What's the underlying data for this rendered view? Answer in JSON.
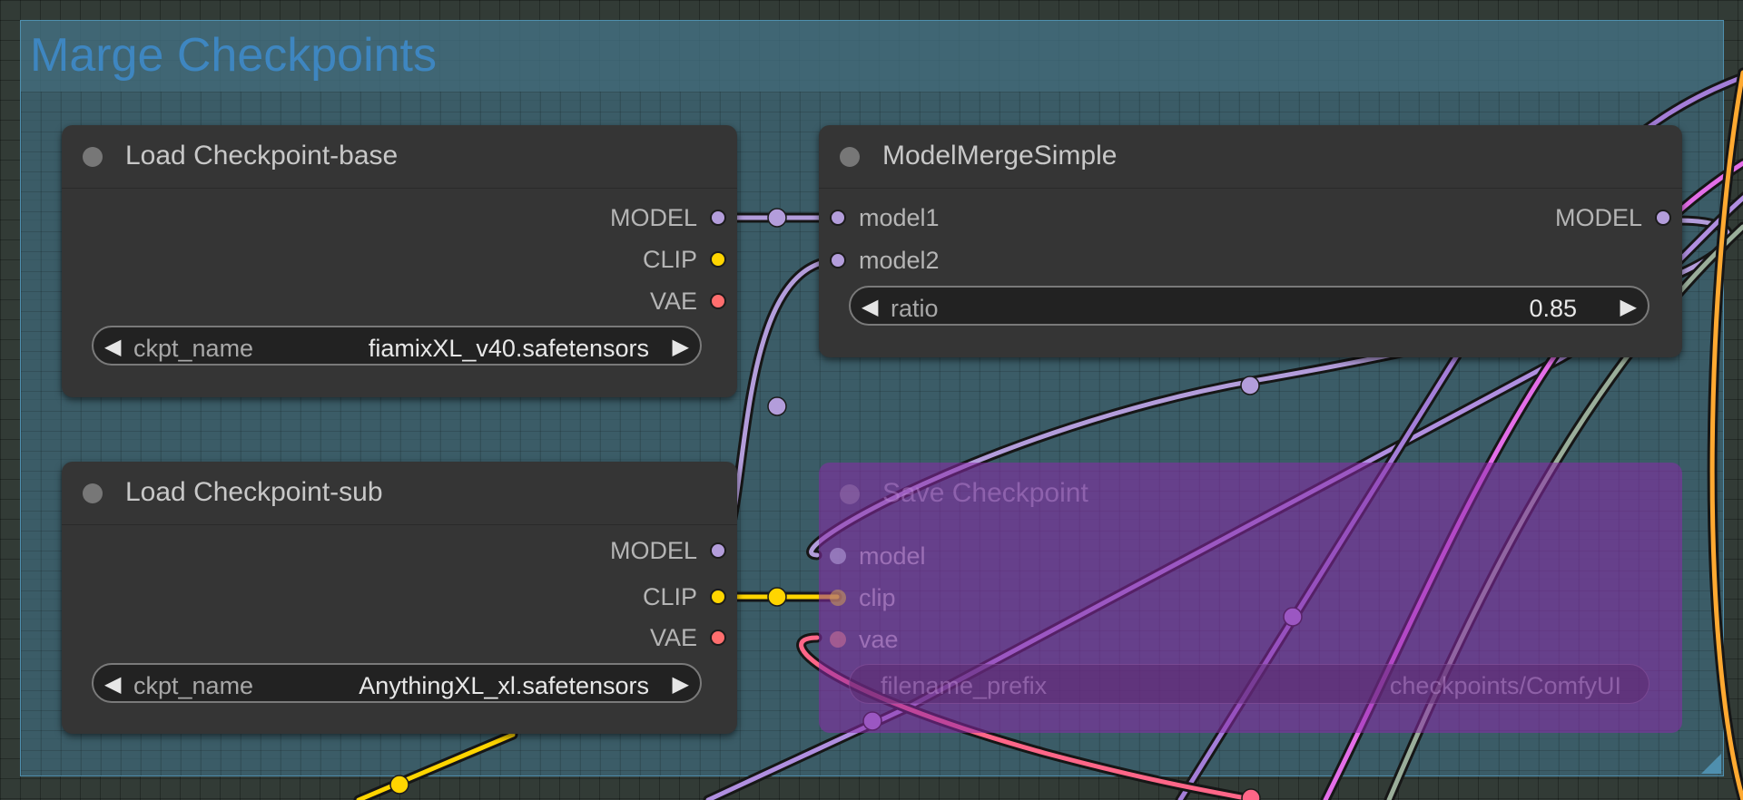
{
  "group": {
    "title": "Marge Checkpoints"
  },
  "nodes": {
    "load_base": {
      "title": "Load Checkpoint-base",
      "outputs": [
        "MODEL",
        "CLIP",
        "VAE"
      ],
      "widget": {
        "name": "ckpt_name",
        "value": "fiamixXL_v40.safetensors"
      }
    },
    "load_sub": {
      "title": "Load Checkpoint-sub",
      "outputs": [
        "MODEL",
        "CLIP",
        "VAE"
      ],
      "widget": {
        "name": "ckpt_name",
        "value": "AnythingXL_xl.safetensors"
      }
    },
    "merge": {
      "title": "ModelMergeSimple",
      "inputs": [
        "model1",
        "model2"
      ],
      "outputs": [
        "MODEL"
      ],
      "widget": {
        "name": "ratio",
        "value": "0.85"
      }
    },
    "save": {
      "title": "Save Checkpoint",
      "mode": "bypassed",
      "inputs": [
        "model",
        "clip",
        "vae"
      ],
      "widget": {
        "name": "filename_prefix",
        "value": "checkpoints/ComfyUI"
      }
    }
  },
  "colors": {
    "model": "#b39ddb",
    "clip": "#ffd500",
    "vae": "#ff6e6e",
    "pink": "#e36ee8",
    "orange": "#ffa931",
    "gray_green": "#9aae9a",
    "group_title": "#3e86c0",
    "bypass": "#8a2aaa"
  },
  "icons": {
    "arrow_left": "◀",
    "arrow_right": "▶"
  }
}
